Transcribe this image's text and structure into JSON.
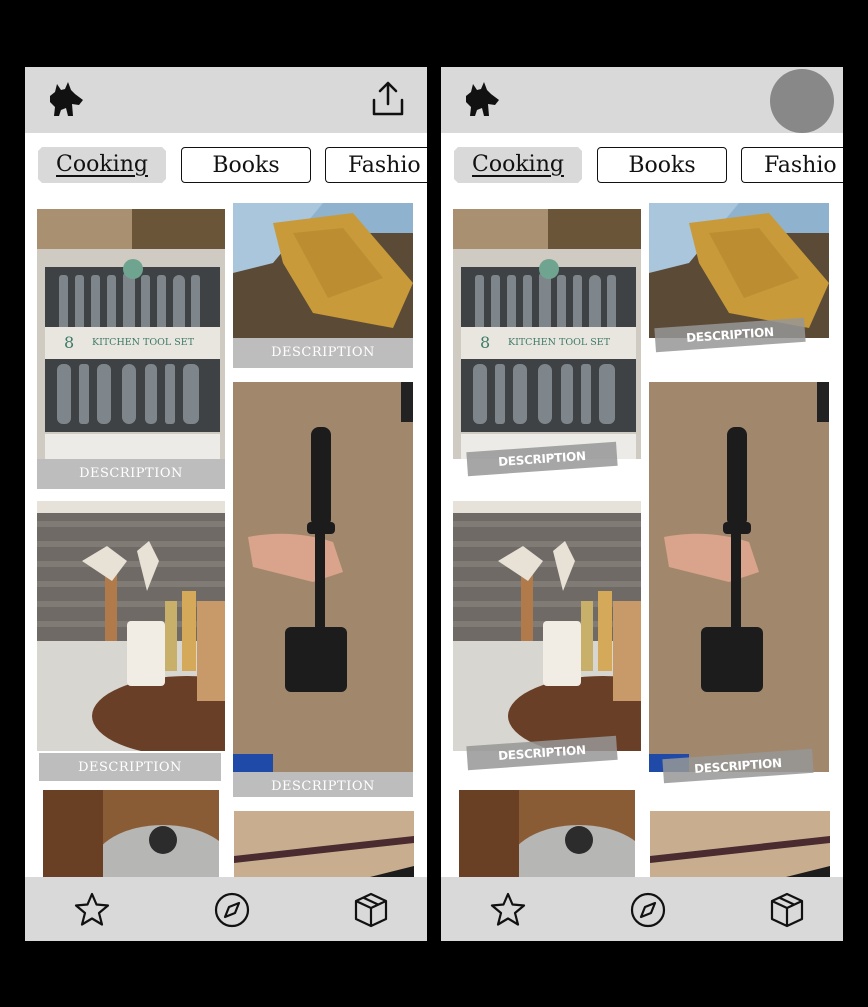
{
  "tabs": {
    "cooking": "Cooking",
    "books": "Books",
    "fashion": "Fashio"
  },
  "cards": {
    "kitchen_tool_set": {
      "description": "DESCRIPTION",
      "package_brand": "KITCHEN TOOL SET",
      "package_count": "8"
    },
    "wooden_spatula": {
      "description": "DESCRIPTION"
    },
    "utensil_holder": {
      "description": "DESCRIPTION"
    },
    "potato_masher": {
      "description": "DESCRIPTION"
    }
  },
  "icons": {
    "logo": "dog-logo-icon",
    "share": "share-icon",
    "avatar": "avatar",
    "favorites": "star-icon",
    "explore": "compass-icon",
    "packages": "box-icon"
  },
  "colors": {
    "bar": "#d9d9d9",
    "description_bg": "#bdbdbd",
    "avatar": "#888888"
  }
}
